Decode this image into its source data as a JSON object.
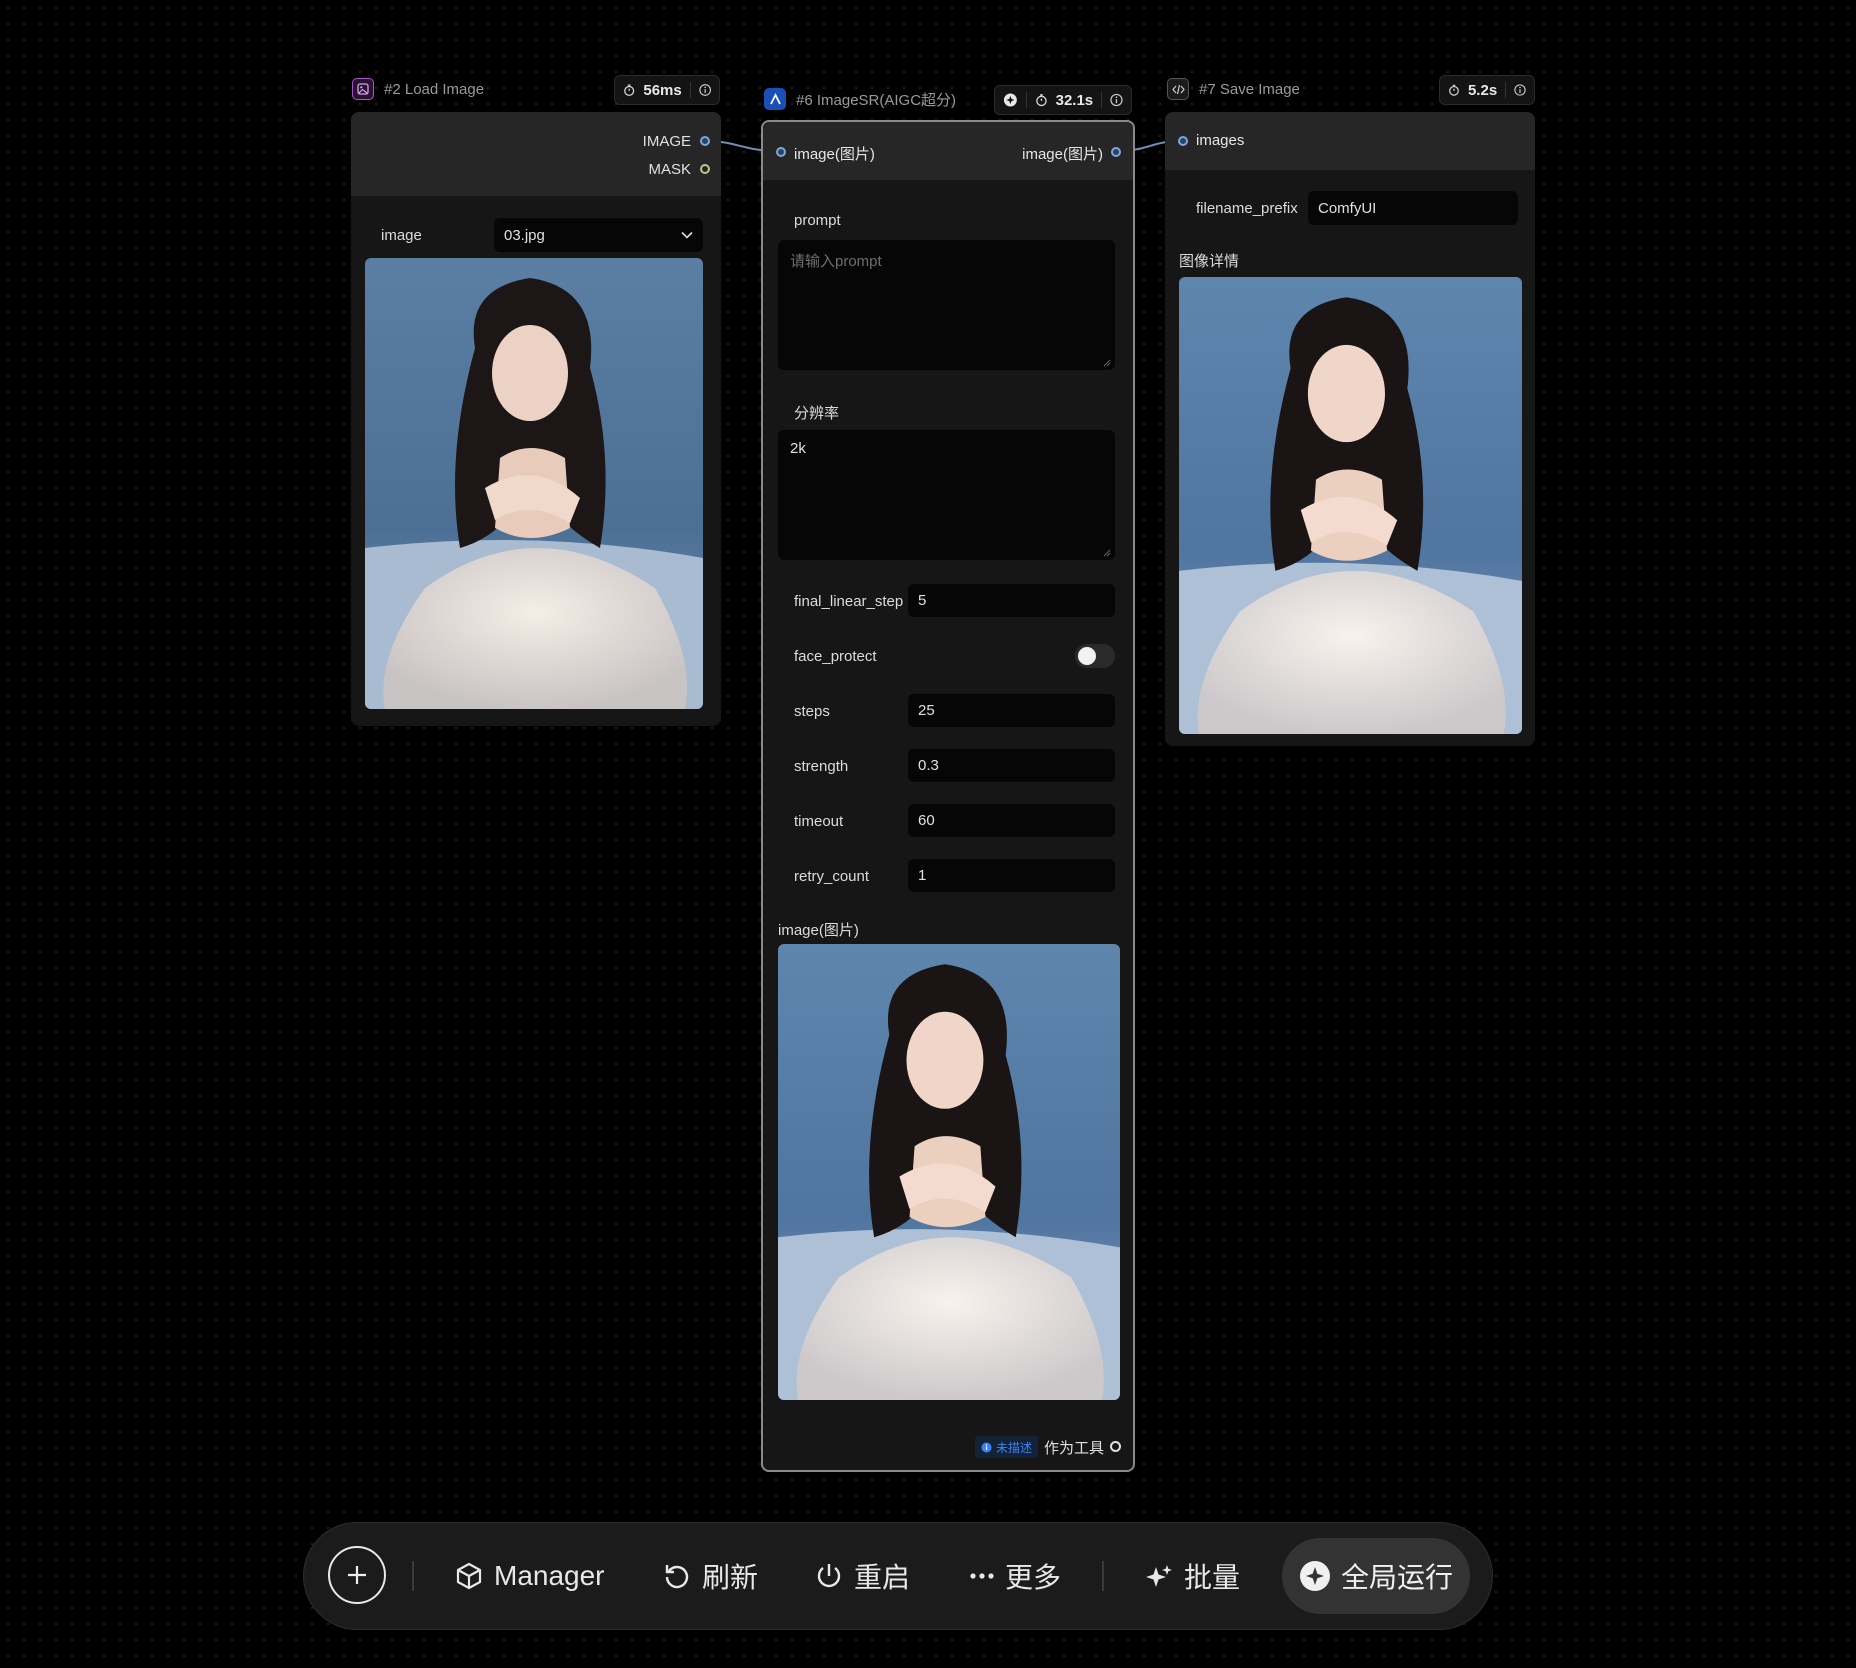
{
  "load_node": {
    "title": "#2 Load Image",
    "time": "56ms",
    "outputs": [
      "IMAGE",
      "MASK"
    ],
    "image_label": "image",
    "image_value": "03.jpg"
  },
  "sr_node": {
    "title": "#6 ImageSR(AIGC超分)",
    "time": "32.1s",
    "input_label": "image(图片)",
    "output_label": "image(图片)",
    "prompt_label": "prompt",
    "prompt_placeholder": "请输入prompt",
    "resolution_label": "分辨率",
    "resolution_value": "2k",
    "fields": [
      {
        "label": "final_linear_step",
        "value": "5"
      },
      {
        "label": "steps",
        "value": "25"
      },
      {
        "label": "strength",
        "value": "0.3"
      },
      {
        "label": "timeout",
        "value": "60"
      },
      {
        "label": "retry_count",
        "value": "1"
      }
    ],
    "face_protect_label": "face_protect",
    "face_protect_on": false,
    "preview_label": "image(图片)",
    "undescribed_badge": "未描述",
    "as_tool_label": "作为工具"
  },
  "save_node": {
    "title": "#7 Save Image",
    "time": "5.2s",
    "input_label": "images",
    "filename_label": "filename_prefix",
    "filename_value": "ComfyUI",
    "details_label": "图像详情"
  },
  "toolbar": {
    "manager": "Manager",
    "refresh": "刷新",
    "restart": "重启",
    "more": "更多",
    "batch": "批量",
    "run_all": "全局运行"
  },
  "colors": {
    "load_icon": "#a855c7",
    "sr_icon": "#1f6feb",
    "link": "#6f8fb3",
    "badge": "#3b82f6"
  }
}
